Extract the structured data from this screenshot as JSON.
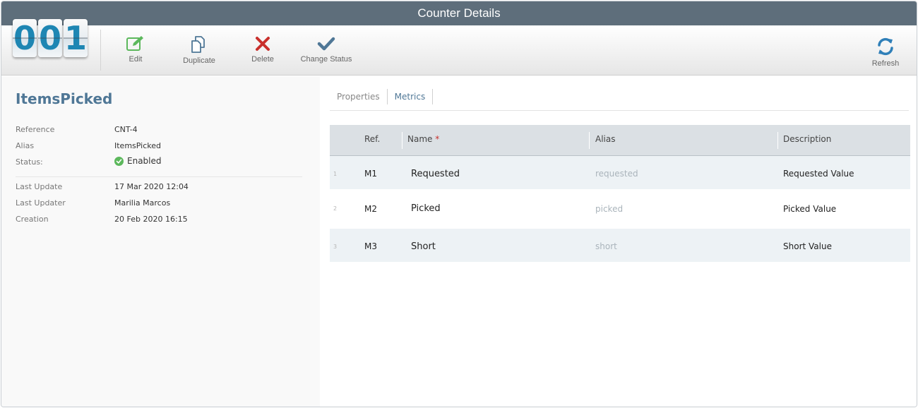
{
  "window": {
    "title": "Counter Details"
  },
  "counter": {
    "digits": [
      "0",
      "0",
      "1"
    ]
  },
  "toolbar": {
    "edit": "Edit",
    "duplicate": "Duplicate",
    "delete": "Delete",
    "change_status": "Change Status",
    "refresh": "Refresh"
  },
  "colors": {
    "edit": "#5cb85c",
    "delete": "#c9302c",
    "accent": "#4f7796",
    "titlebar": "#5e6e7b"
  },
  "details": {
    "name": "ItemsPicked",
    "reference_label": "Reference",
    "reference": "CNT-4",
    "alias_label": "Alias",
    "alias": "ItemsPicked",
    "status_label": "Status:",
    "status": "Enabled",
    "last_update_label": "Last Update",
    "last_update": "17 Mar 2020 12:04",
    "last_updater_label": "Last Updater",
    "last_updater": "Marilia Marcos",
    "creation_label": "Creation",
    "creation": "20 Feb 2020 16:15"
  },
  "tabs": [
    "Properties",
    "Metrics"
  ],
  "table": {
    "headers": {
      "ref": "Ref.",
      "name": "Name",
      "required": "*",
      "alias": "Alias",
      "description": "Description"
    },
    "rows": [
      {
        "num": "1",
        "ref": "M1",
        "name": "Requested",
        "alias": "requested",
        "description": "Requested Value"
      },
      {
        "num": "2",
        "ref": "M2",
        "name": "Picked",
        "alias": "picked",
        "description": "Picked Value"
      },
      {
        "num": "3",
        "ref": "M3",
        "name": "Short",
        "alias": "short",
        "description": "Short Value"
      }
    ]
  }
}
